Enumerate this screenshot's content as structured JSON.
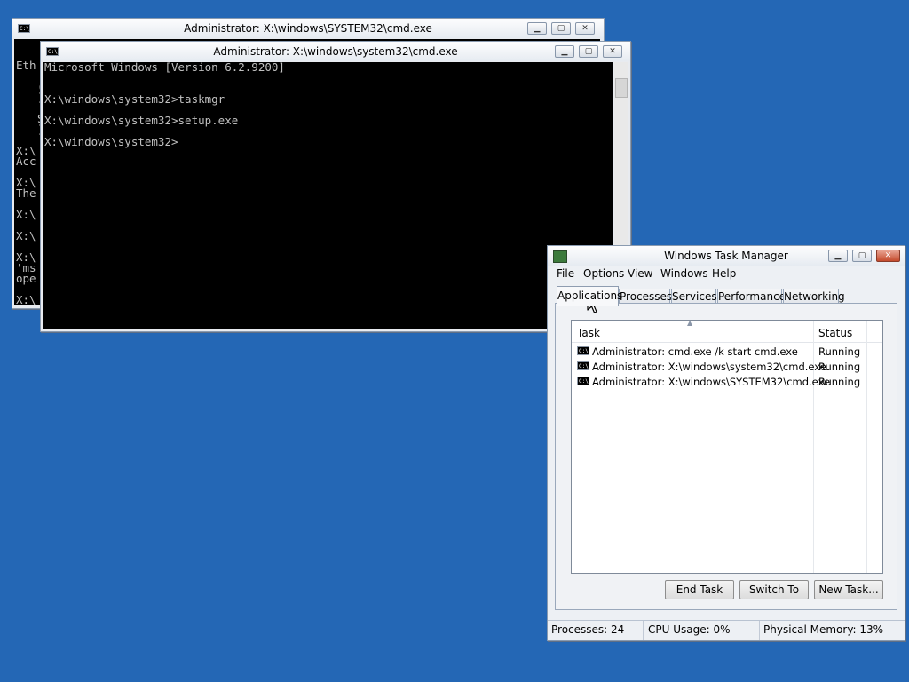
{
  "back_console": {
    "title": "Administrator: X:\\windows\\SYSTEM32\\cmd.exe",
    "controls": [
      "minimize",
      "maximize",
      "close"
    ],
    "visible_text": [
      {
        "text": "Eth"
      },
      {
        "text": "("
      },
      {
        "text": "]"
      },
      {
        "text": "S"
      },
      {
        "text": "]"
      },
      {
        "text": "X:\\"
      },
      {
        "text": "Acc"
      },
      {
        "text": "X:\\"
      },
      {
        "text": "The"
      },
      {
        "text": "X:\\"
      },
      {
        "text": "X:\\"
      },
      {
        "text": "X:\\"
      },
      {
        "text": "'ms"
      },
      {
        "text": "ope"
      },
      {
        "text": "X:\\"
      }
    ]
  },
  "front_console": {
    "title": "Administrator: X:\\windows\\system32\\cmd.exe",
    "lines": [
      "Microsoft Windows [Version 6.2.9200]",
      "X:\\windows\\system32>taskmgr",
      "X:\\windows\\system32>setup.exe",
      "X:\\windows\\system32>"
    ]
  },
  "task_manager": {
    "title": "Windows Task Manager",
    "menu": [
      "File",
      "Options",
      "View",
      "Windows",
      "Help"
    ],
    "tabs": [
      "Applications",
      "Processes",
      "Services",
      "Performance",
      "Networking"
    ],
    "active_tab": "Applications",
    "columns": {
      "task": "Task",
      "status": "Status"
    },
    "rows": [
      {
        "task": "Administrator: cmd.exe /k start cmd.exe",
        "status": "Running"
      },
      {
        "task": "Administrator: X:\\windows\\system32\\cmd.exe",
        "status": "Running"
      },
      {
        "task": "Administrator: X:\\windows\\SYSTEM32\\cmd.exe",
        "status": "Running"
      }
    ],
    "buttons": {
      "end_task": "End Task",
      "switch_to": "Switch To",
      "new_task": "New Task..."
    },
    "status_bar": {
      "processes": "Processes: 24",
      "cpu": "CPU Usage: 0%",
      "memory": "Physical Memory: 13%"
    }
  },
  "colors": {
    "desktop": "#2467b5",
    "console_bg": "#000000",
    "console_fg": "#c0c0c0"
  },
  "icons": {
    "console_icon": "cmd-icon",
    "taskmgr_icon": "taskmgr-icon",
    "window_controls": [
      "minimize-icon",
      "maximize-icon",
      "close-icon"
    ],
    "pointer": "mouse-cursor-icon"
  }
}
